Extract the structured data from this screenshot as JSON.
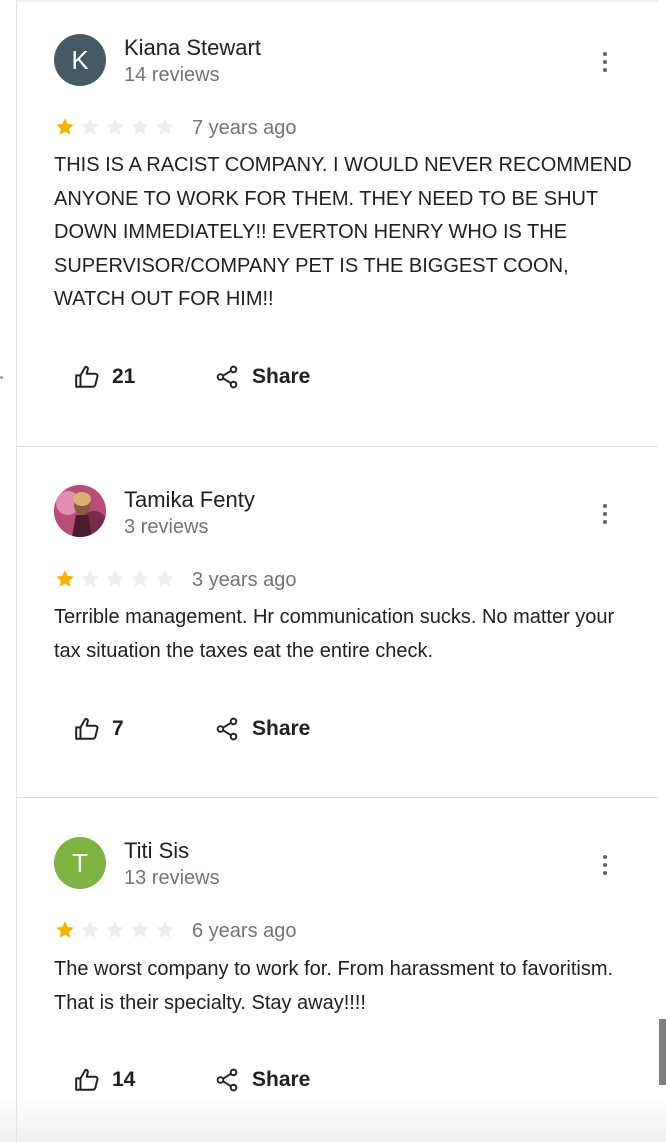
{
  "colors": {
    "star_filled": "#f5b400",
    "star_empty": "#eeeeee",
    "avatar_k": "#455a64",
    "avatar_t": "#7cb342",
    "muted_text": "#70757a"
  },
  "icons": {
    "like": "thumbs-up-icon",
    "share": "share-icon",
    "more": "more-vert-icon",
    "star": "star-icon"
  },
  "reviews": [
    {
      "initial": "K",
      "name": "Kiana Stewart",
      "review_count": "14 reviews",
      "rating": 1,
      "date": "7 years ago",
      "text": "THIS IS A RACIST COMPANY. I WOULD NEVER RECOMMEND ANYONE TO WORK FOR THEM. THEY NEED TO BE SHUT DOWN IMMEDIATELY!! EVERTON HENRY WHO IS THE SUPERVISOR/COMPANY PET IS THE BIGGEST COON, WATCH OUT FOR HIM!!",
      "likes": "21",
      "share_label": "Share"
    },
    {
      "initial": "",
      "name": "Tamika Fenty",
      "review_count": "3 reviews",
      "rating": 1,
      "date": "3 years ago",
      "text": "Terrible management. Hr communication sucks. No matter your tax situation the taxes eat the entire check.",
      "likes": "7",
      "share_label": "Share"
    },
    {
      "initial": "T",
      "name": "Titi Sis",
      "review_count": "13 reviews",
      "rating": 1,
      "date": "6 years ago",
      "text": "The worst company to work for. From harassment to favoritism. That is their specialty. Stay away!!!!",
      "likes": "14",
      "share_label": "Share"
    }
  ]
}
